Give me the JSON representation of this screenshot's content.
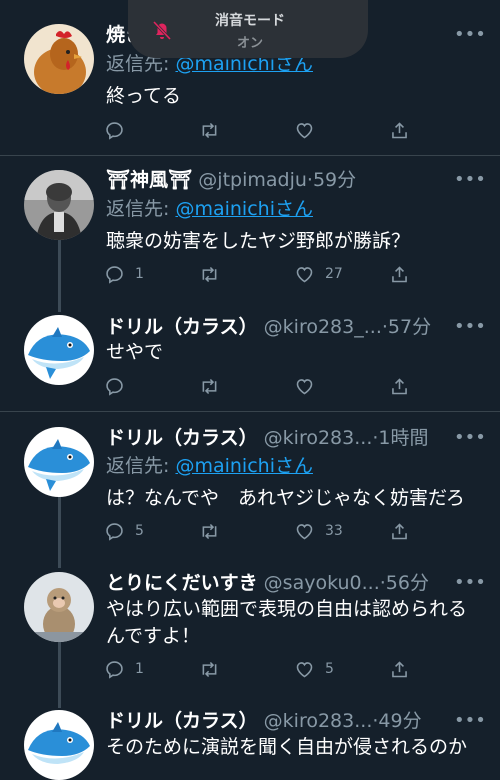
{
  "notification": {
    "title": "消音モード",
    "subtitle": "オン",
    "icon": "bell-slash-icon",
    "icon_color": "#e0245e"
  },
  "colors": {
    "background": "#15202b",
    "mention": "#1da1f2",
    "muted": "#8899a6"
  },
  "tweets": [
    {
      "name": "焼き",
      "handle": "",
      "time": "",
      "reply_prefix": "返信先: ",
      "reply_to": "@mainichiさん",
      "text": "終ってる",
      "reply_count": "",
      "like_count": ""
    },
    {
      "name": "⛩神風⛩",
      "handle": "@jtpimadju",
      "time": "·59分",
      "reply_prefix": "返信先: ",
      "reply_to": "@mainichiさん",
      "text": "聴衆の妨害をしたヤジ野郎が勝訴？",
      "reply_count": "1",
      "like_count": "27"
    },
    {
      "name": "ドリル（カラス）",
      "handle": "@kiro283_...",
      "time": "·57分",
      "text": "せやで",
      "reply_count": "",
      "like_count": ""
    },
    {
      "name": "ドリル（カラス）",
      "handle": "@kiro283...",
      "time": "·1時間",
      "reply_prefix": "返信先: ",
      "reply_to": "@mainichiさん",
      "text": "は？なんでや　あれヤジじゃなく妨害だろ",
      "reply_count": "5",
      "like_count": "33"
    },
    {
      "name": "とりにくだいすき",
      "handle": "@sayoku0...",
      "time": "·56分",
      "text_line1": "やはり広い範囲で表現の自由は認められる",
      "text_line2": "んですよ！",
      "reply_count": "1",
      "like_count": "5"
    },
    {
      "name": "ドリル（カラス）",
      "handle": "@kiro283...",
      "time": "·49分",
      "text": "そのために演説を聞く自由が侵されるのか"
    }
  ]
}
